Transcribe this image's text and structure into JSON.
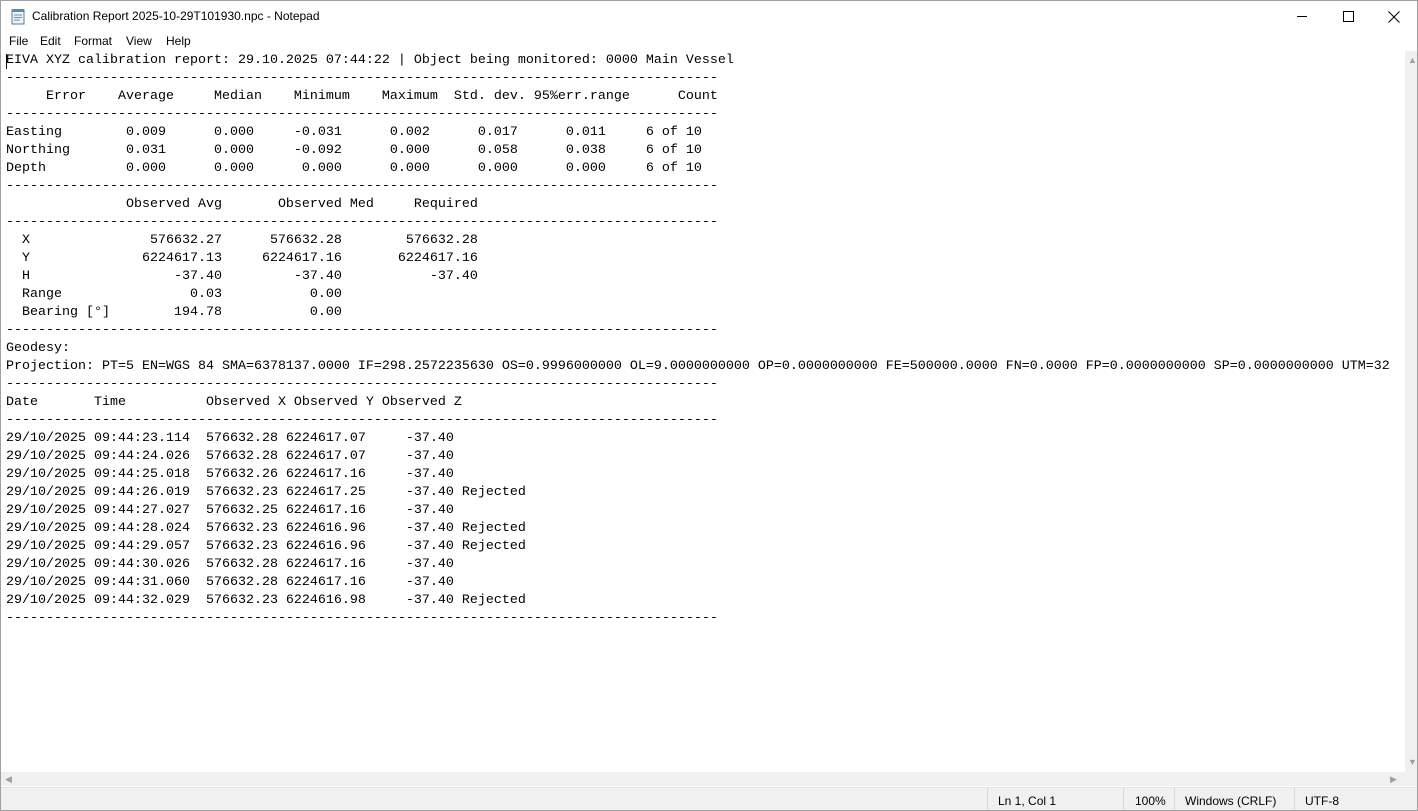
{
  "window": {
    "title": "Calibration Report 2025-10-29T101930.npc - Notepad",
    "app_icon": "notepad-icon",
    "controls": [
      "minimize-icon",
      "maximize-icon",
      "close-icon"
    ]
  },
  "menu": [
    "File",
    "Edit",
    "Format",
    "View",
    "Help"
  ],
  "document": {
    "lines": [
      "EIVA XYZ calibration report: 29.10.2025 07:44:22 | Object being monitored: 0000 Main Vessel",
      "-----------------------------------------------------------------------------------------",
      "     Error    Average     Median    Minimum    Maximum  Std. dev. 95%err.range      Count",
      "-----------------------------------------------------------------------------------------",
      "Easting        0.009      0.000     -0.031      0.002      0.017      0.011     6 of 10",
      "Northing       0.031      0.000     -0.092      0.000      0.058      0.038     6 of 10",
      "Depth          0.000      0.000      0.000      0.000      0.000      0.000     6 of 10",
      "-----------------------------------------------------------------------------------------",
      "               Observed Avg       Observed Med     Required",
      "-----------------------------------------------------------------------------------------",
      "  X               576632.27      576632.28        576632.28",
      "  Y              6224617.13     6224617.16       6224617.16",
      "  H                  -37.40         -37.40           -37.40",
      "  Range                0.03           0.00",
      "  Bearing [°]        194.78           0.00",
      "-----------------------------------------------------------------------------------------",
      "Geodesy:",
      "Projection: PT=5 EN=WGS 84 SMA=6378137.0000 IF=298.2572235630 OS=0.9996000000 OL=9.0000000000 OP=0.0000000000 FE=500000.0000 FN=0.0000 FP=0.0000000000 SP=0.0000000000 UTM=32",
      "-----------------------------------------------------------------------------------------",
      "Date       Time          Observed X Observed Y Observed Z",
      "-----------------------------------------------------------------------------------------",
      "29/10/2025 09:44:23.114  576632.28 6224617.07     -37.40",
      "29/10/2025 09:44:24.026  576632.28 6224617.07     -37.40",
      "29/10/2025 09:44:25.018  576632.26 6224617.16     -37.40",
      "29/10/2025 09:44:26.019  576632.23 6224617.25     -37.40 Rejected",
      "29/10/2025 09:44:27.027  576632.25 6224617.16     -37.40",
      "29/10/2025 09:44:28.024  576632.23 6224616.96     -37.40 Rejected",
      "29/10/2025 09:44:29.057  576632.23 6224616.96     -37.40 Rejected",
      "29/10/2025 09:44:30.026  576632.28 6224617.16     -37.40",
      "29/10/2025 09:44:31.060  576632.28 6224617.16     -37.40",
      "29/10/2025 09:44:32.029  576632.23 6224616.98     -37.40 Rejected",
      "-----------------------------------------------------------------------------------------"
    ]
  },
  "status": {
    "position": "Ln 1, Col 1",
    "zoom": "100%",
    "line_ending": "Windows (CRLF)",
    "encoding": "UTF-8"
  }
}
